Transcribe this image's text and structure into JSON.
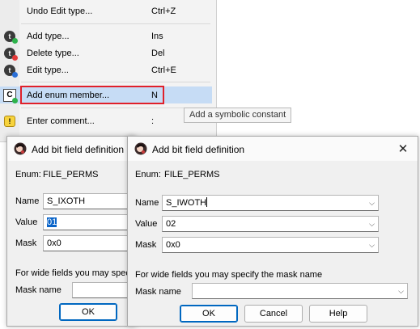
{
  "menu": {
    "items": [
      {
        "label": "Undo Edit type...",
        "shortcut": "Ctrl+Z"
      },
      {
        "label": "Add type...",
        "shortcut": "Ins"
      },
      {
        "label": "Delete type...",
        "shortcut": "Del"
      },
      {
        "label": "Edit type...",
        "shortcut": "Ctrl+E"
      },
      {
        "label": "Add enum member...",
        "shortcut": "N"
      },
      {
        "label": "Enter comment...",
        "shortcut": ":"
      }
    ],
    "icon_glyphs": {
      "type": "t",
      "enum": "C",
      "comment": "!"
    },
    "highlight_color": "#e0202a"
  },
  "tooltip": {
    "text": "Add a symbolic constant"
  },
  "back_dialog": {
    "title": "Add bit field definition",
    "enum_label": "Enum:",
    "enum_value": "FILE_PERMS",
    "name_label": "Name",
    "name_value": "S_IXOTH",
    "value_label": "Value",
    "value_value": "01",
    "mask_label": "Mask",
    "mask_value": "0x0",
    "wide_hint": "For wide fields you may specify",
    "mask_name_label": "Mask name",
    "ok_label": "OK"
  },
  "front_dialog": {
    "title": "Add bit field definition",
    "close_glyph": "✕",
    "enum_label": "Enum:",
    "enum_value": "FILE_PERMS",
    "name_label": "Name",
    "name_value": "S_IWOTH",
    "value_label": "Value",
    "value_value": "02",
    "mask_label": "Mask",
    "mask_value": "0x0",
    "wide_hint": "For wide fields you may specify the mask name",
    "mask_name_label": "Mask name",
    "mask_name_value": "",
    "ok_label": "OK",
    "cancel_label": "Cancel",
    "help_label": "Help",
    "chevron_glyph": "⌵"
  }
}
